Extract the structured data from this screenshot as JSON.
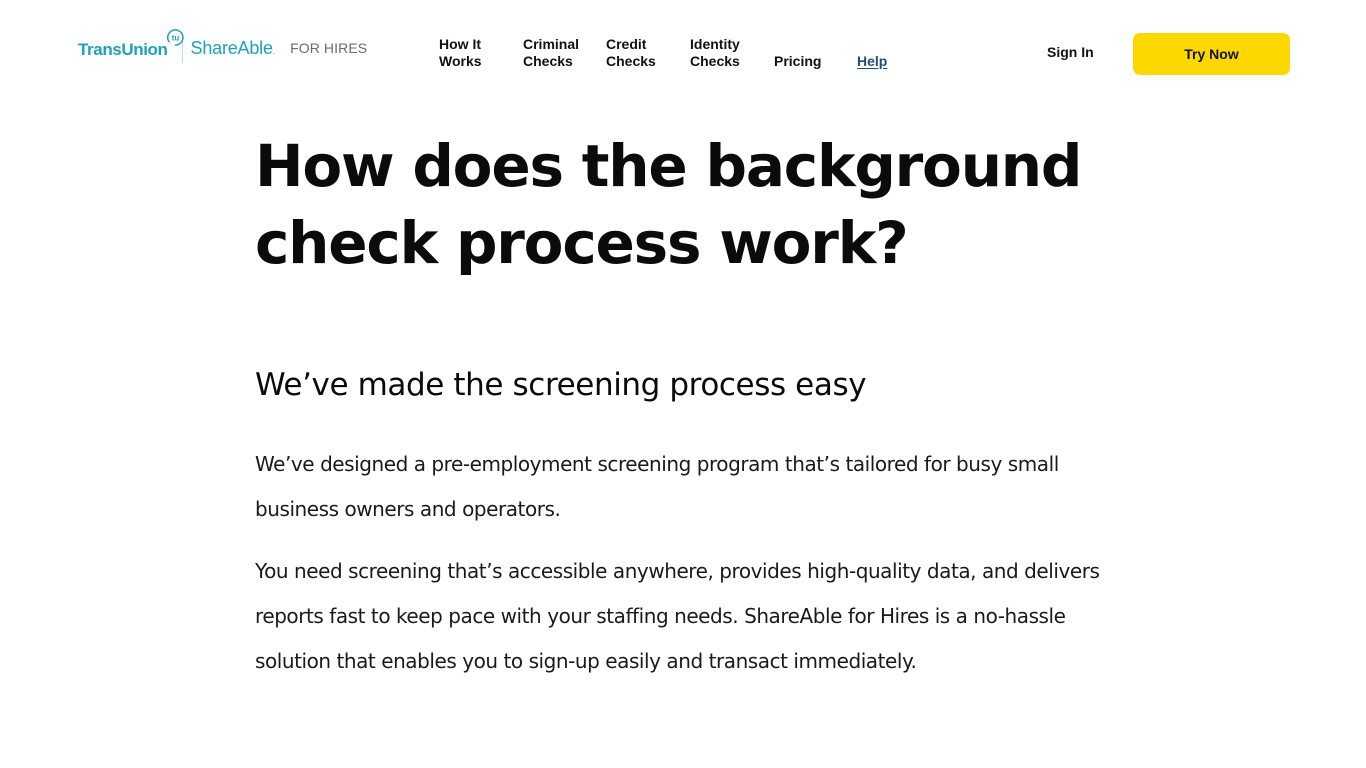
{
  "brand": {
    "transunion_label": "TransUnion",
    "tu_mark_label": "tu",
    "product_label": "ShareAble",
    "product_suffix": ".",
    "segment_label": "FOR HIRES",
    "brand_color": "#1fa2b7"
  },
  "nav": {
    "items": [
      {
        "label": "How It\nWorks"
      },
      {
        "label": "Criminal\nChecks"
      },
      {
        "label": "Credit\nChecks"
      },
      {
        "label": "Identity\nChecks"
      },
      {
        "label": "Pricing"
      },
      {
        "label": "Help"
      }
    ],
    "help_color": "#1f4f78"
  },
  "actions": {
    "sign_in_label": "Sign In",
    "try_now_label": "Try Now",
    "try_now_color": "#fcd800"
  },
  "main": {
    "title": "How does the background check process work?",
    "subheading": "We’ve made the screening process easy",
    "paragraphs": [
      "We’ve designed a pre-employment screening program that’s tailored for busy small business owners and operators.",
      "You need screening that’s accessible anywhere, provides high-quality data, and delivers reports fast to keep pace with your staffing needs. ShareAble for Hires is a no-hassle solution that enables you to sign-up easily and transact immediately."
    ]
  }
}
